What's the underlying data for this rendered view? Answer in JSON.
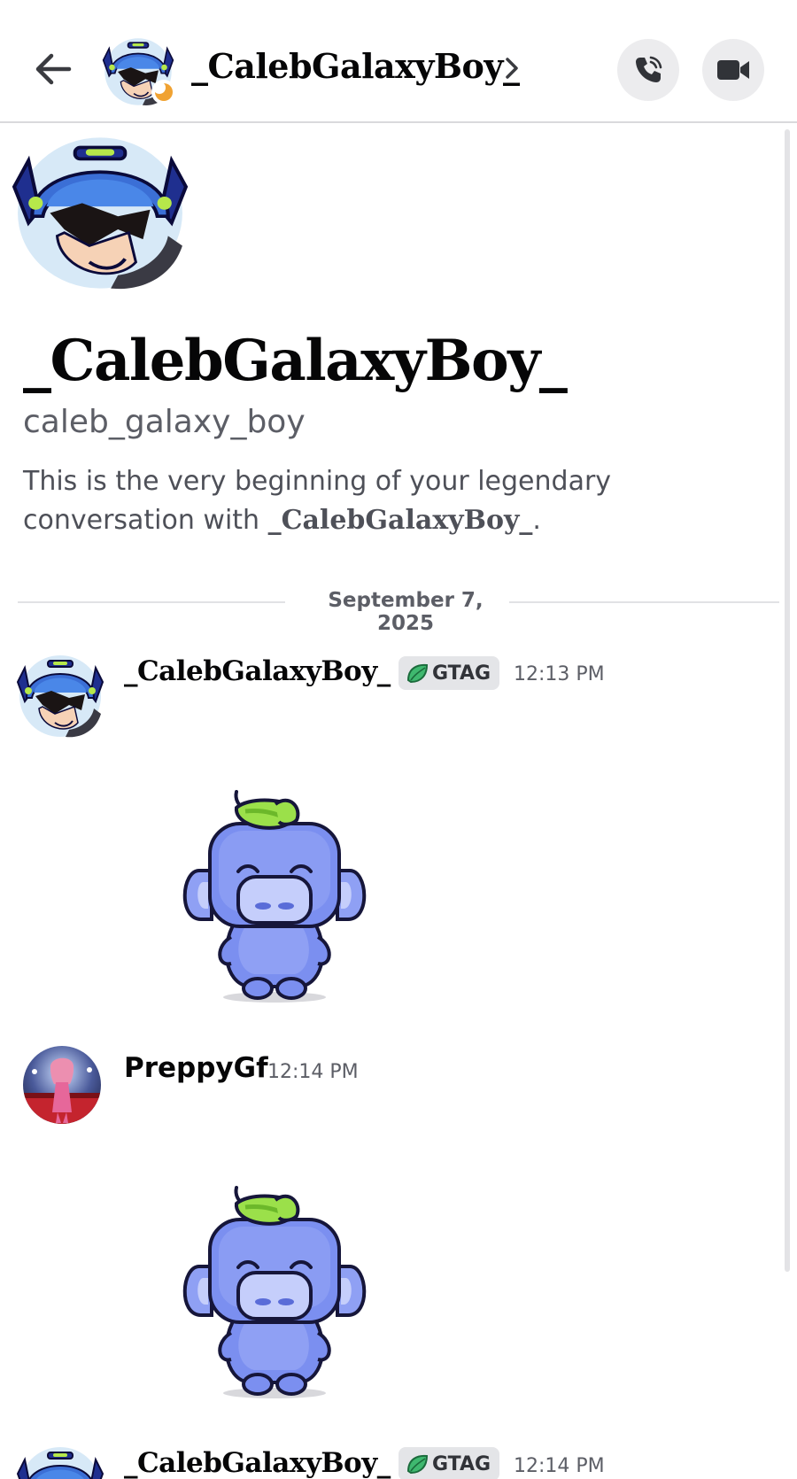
{
  "header": {
    "title": "_CalebGalaxyBoy_"
  },
  "intro": {
    "display_name": "_CalebGalaxyBoy_",
    "username": "caleb_galaxy_boy",
    "text_before": "This is the very beginning of your legendary conversation with ",
    "mention": "_CalebGalaxyBoy_",
    "text_after": "."
  },
  "date_divider": "September 7, 2025",
  "messages": [
    {
      "author": "_CalebGalaxyBoy_",
      "tag": "GTAG",
      "time": "12:13 PM"
    },
    {
      "author": "PreppyGf",
      "time": "12:14 PM"
    },
    {
      "author": "_CalebGalaxyBoy_",
      "tag": "GTAG",
      "time": "12:14 PM"
    }
  ],
  "colors": {
    "sticker_body": "#7b8ff0",
    "sticker_leaf": "#9be04a",
    "tag_leaf": "#3fb86f",
    "status_moon": "#f0a232"
  },
  "icons": {
    "back": "arrow-left-icon",
    "call": "phone-icon",
    "video": "video-camera-icon",
    "chevron": "chevron-right-icon",
    "status": "idle-moon-icon"
  }
}
